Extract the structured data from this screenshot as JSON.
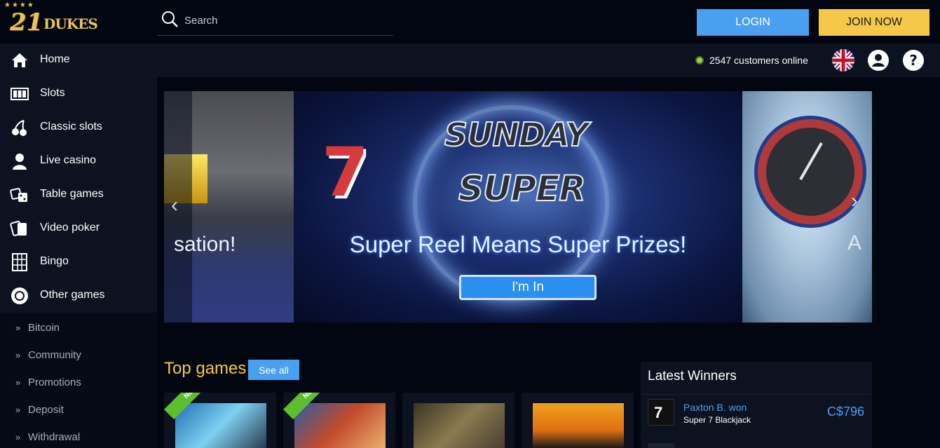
{
  "brand": {
    "logo_number": "21",
    "logo_word": "DUKES",
    "logo_stars": "★★★★"
  },
  "search": {
    "placeholder": "Search"
  },
  "header": {
    "login_label": "LOGIN",
    "join_label": "JOIN NOW"
  },
  "status": {
    "online_text": "2547 customers online"
  },
  "icons": {
    "flag": "uk-flag-icon",
    "user": "user-icon",
    "help": "help-icon",
    "search": "search-icon"
  },
  "sidebar": {
    "items": [
      {
        "label": "Home",
        "icon": "home-icon"
      },
      {
        "label": "Slots",
        "icon": "slots-icon"
      },
      {
        "label": "Classic slots",
        "icon": "cherries-icon"
      },
      {
        "label": "Live casino",
        "icon": "dealer-icon"
      },
      {
        "label": "Table games",
        "icon": "dice-icon"
      },
      {
        "label": "Video poker",
        "icon": "cards-icon"
      },
      {
        "label": "Bingo",
        "icon": "bingo-card-icon"
      },
      {
        "label": "Other games",
        "icon": "chip-icon"
      }
    ],
    "sub_items": [
      {
        "label": "Bitcoin"
      },
      {
        "label": "Community"
      },
      {
        "label": "Promotions"
      },
      {
        "label": "Deposit"
      },
      {
        "label": "Withdrawal"
      }
    ],
    "chevron": "»"
  },
  "banner": {
    "left_text": "sation!",
    "headline_1": "SUNDAY",
    "headline_2": "SUPER",
    "seven": "7",
    "tagline": "Super Reel Means Super Prizes!",
    "cta_label": "I'm In",
    "right_text": "A",
    "arrow_left": "‹",
    "arrow_right": "›"
  },
  "top_games": {
    "title": "Top games",
    "see_all_label": "See all",
    "badge": "NEW"
  },
  "winners": {
    "title": "Latest Winners",
    "rows": [
      {
        "name": "Paxton B. won",
        "game": "Super 7 Blackjack",
        "amount": "C$796",
        "thumb_text": "7"
      }
    ]
  },
  "colors": {
    "accent_blue": "#4aa0f0",
    "accent_yellow": "#f5c84a",
    "background": "#020611",
    "panel": "#0d1220",
    "online_green": "#9ccf3c"
  }
}
